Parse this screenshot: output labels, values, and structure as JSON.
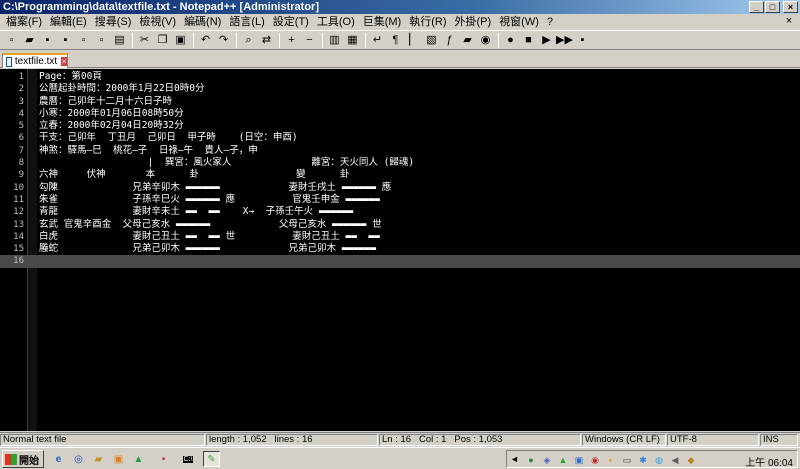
{
  "window": {
    "title": "C:\\Programming\\data\\textfile.txt - Notepad++ [Administrator]",
    "min": "_",
    "max": "□",
    "close": "×"
  },
  "menu": [
    "檔案(F)",
    "編輯(E)",
    "搜尋(S)",
    "檢視(V)",
    "編碼(N)",
    "語言(L)",
    "設定(T)",
    "工具(O)",
    "巨集(M)",
    "執行(R)",
    "外掛(P)",
    "視窗(W)",
    "?"
  ],
  "menu_close": "×",
  "toolbar": [
    {
      "icon": "new-file-icon",
      "glyph": "▫"
    },
    {
      "icon": "open-folder-icon",
      "glyph": "▰"
    },
    {
      "icon": "save-icon",
      "glyph": "▪"
    },
    {
      "icon": "save-all-icon",
      "glyph": "▪"
    },
    {
      "icon": "close-file-icon",
      "glyph": "▫"
    },
    {
      "icon": "close-all-icon",
      "glyph": "▫"
    },
    {
      "icon": "print-icon",
      "glyph": "▤"
    },
    {
      "sep": true
    },
    {
      "icon": "cut-icon",
      "glyph": "✂"
    },
    {
      "icon": "copy-icon",
      "glyph": "❐"
    },
    {
      "icon": "paste-icon",
      "glyph": "▣"
    },
    {
      "sep": true
    },
    {
      "icon": "undo-icon",
      "glyph": "↶"
    },
    {
      "icon": "redo-icon",
      "glyph": "↷"
    },
    {
      "sep": true
    },
    {
      "icon": "find-icon",
      "glyph": "⌕"
    },
    {
      "icon": "replace-icon",
      "glyph": "⇄"
    },
    {
      "sep": true
    },
    {
      "icon": "zoom-in-icon",
      "glyph": "+"
    },
    {
      "icon": "zoom-out-icon",
      "glyph": "−"
    },
    {
      "sep": true
    },
    {
      "icon": "sync-vertical-icon",
      "glyph": "▥"
    },
    {
      "icon": "sync-horizontal-icon",
      "glyph": "▦"
    },
    {
      "sep": true
    },
    {
      "icon": "word-wrap-icon",
      "glyph": "↵"
    },
    {
      "icon": "show-all-chars-icon",
      "glyph": "¶"
    },
    {
      "icon": "indent-guide-icon",
      "glyph": "▏"
    },
    {
      "icon": "doc-map-icon",
      "glyph": "▧"
    },
    {
      "icon": "function-list-icon",
      "glyph": "ƒ"
    },
    {
      "icon": "folder-workspace-icon",
      "glyph": "▰"
    },
    {
      "icon": "monitoring-icon",
      "glyph": "◉"
    },
    {
      "sep": true
    },
    {
      "icon": "record-macro-icon",
      "glyph": "●"
    },
    {
      "icon": "stop-macro-icon",
      "glyph": "■"
    },
    {
      "icon": "play-macro-icon",
      "glyph": "▶"
    },
    {
      "icon": "play-multiple-icon",
      "glyph": "▶▶"
    },
    {
      "icon": "save-macro-icon",
      "glyph": "▪"
    }
  ],
  "tab": {
    "label": "textfile.txt",
    "close": "×"
  },
  "lines": [
    {
      "n": "1",
      "text": "Page：第00頁"
    },
    {
      "n": "2",
      "text": "公曆起卦時間：2000年1月22日0時0分"
    },
    {
      "n": "3",
      "text": "農曆：己卯年十二月十六日子時"
    },
    {
      "n": "4",
      "text": "小寒：2000年01月06日08時50分"
    },
    {
      "n": "5",
      "text": "立春：2000年02月04日20時32分"
    },
    {
      "n": "6",
      "text": "干支：己卯年  丁丑月  己卯日  甲子時    (日空：申酉)"
    },
    {
      "n": "7",
      "text": "神煞：驛馬—巳  桃花—子  日祿—午  貴人—子，申"
    },
    {
      "n": "8",
      "text": "                   |  巽宮：風火家人              離宮：天火同人 (歸魂)"
    },
    {
      "n": "9",
      "text": "六神     伏神       本      卦                 變      卦"
    },
    {
      "n": "10",
      "text": "勾陳             兄弟辛卯木 ▬▬▬▬▬▬            妻財壬戌土 ▬▬▬▬▬▬ 應"
    },
    {
      "n": "11",
      "text": "朱雀             子孫辛巳火 ▬▬▬▬▬▬ 應          官鬼壬申金 ▬▬▬▬▬▬"
    },
    {
      "n": "12",
      "text": "青龍             妻財辛未土 ▬▬  ▬▬    X→  子孫壬午火 ▬▬▬▬▬▬"
    },
    {
      "n": "13",
      "text": "玄武 官鬼辛酉金  父母己亥水 ▬▬▬▬▬▬            父母己亥水 ▬▬▬▬▬▬ 世"
    },
    {
      "n": "14",
      "text": "白虎             妻財己丑土 ▬▬  ▬▬ 世          妻財己丑土 ▬▬  ▬▬"
    },
    {
      "n": "15",
      "text": "螣蛇             兄弟己卯木 ▬▬▬▬▬▬            兄弟己卯木 ▬▬▬▬▬▬"
    },
    {
      "n": "16",
      "text": ""
    }
  ],
  "status": {
    "filetype": "Normal text file",
    "length": "length : 1,052",
    "lines": "lines : 16",
    "ln": "Ln : 16",
    "col": "Col : 1",
    "pos": "Pos : 1,053",
    "eol": "Windows (CR LF)",
    "encoding": "UTF-8",
    "ins": "INS"
  },
  "taskbar": {
    "start": "開始",
    "clock": "上午 06:04"
  }
}
